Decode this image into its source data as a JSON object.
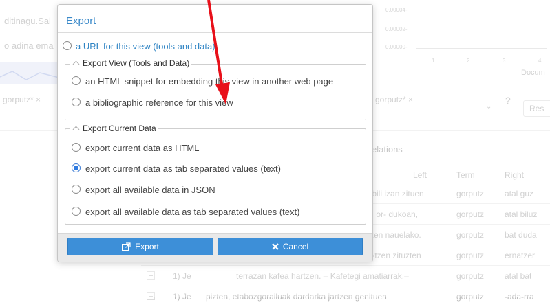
{
  "background": {
    "left_text_1": "ditinagu.Sal",
    "left_text_2": "o adina ema",
    "chip_left": "gorputz*",
    "chip_left_x": "×",
    "chip_right": "gorputz*",
    "chip_right_x": "×",
    "help": "?",
    "reset": "Res",
    "relations": "elations",
    "chart_ticks_y": [
      "0.00004-",
      "0.00002-",
      "0.00000-"
    ],
    "chart_ticks_x": [
      "1",
      "2",
      "3",
      "4"
    ],
    "chart_side_label": "Docum",
    "table": {
      "headers": [
        "Left",
        "Term",
        "Right"
      ],
      "rows": [
        {
          "id": "",
          "left": "erabili izan zituen",
          "term": "gorputz",
          "right": "atal guz"
        },
        {
          "id": "",
          "left": "eta, or- dukoan,",
          "term": "gorputz",
          "right": "atal biluz"
        },
        {
          "id": "",
          "left": "ratzen nauelako.",
          "term": "gorputz",
          "right": "bat duda"
        },
        {
          "id": "",
          "left": "arri-tzen zituzten",
          "term": "gorputz",
          "right": "ernatzer"
        },
        {
          "id": "1) Je",
          "left": "terrazan kafea hartzen. – Kafetegi amatiarrak.–",
          "term": "gorputz",
          "right": "atal bat"
        },
        {
          "id": "1) Je",
          "left": "pizten, etabozgorailuak dardarka jartzen genituen",
          "term": "gorputz",
          "right": "-ada-rra"
        }
      ]
    }
  },
  "dialog": {
    "title": "Export",
    "url_option": "a URL for this view (tools and data)",
    "view_group": {
      "legend": "Export View (Tools and Data)",
      "options": [
        "an HTML snippet for embedding this view in another web page",
        "a bibliographic reference for this view"
      ]
    },
    "data_group": {
      "legend": "Export Current Data",
      "options": [
        "export current data as HTML",
        "export current data as tab separated values (text)",
        "export all available data in JSON",
        "export all available data as tab separated values (text)"
      ],
      "selected": "export current data as tab separated values (text)"
    },
    "buttons": {
      "export": "Export",
      "export_icon": "external-link-icon",
      "cancel": "Cancel",
      "cancel_icon": "x-icon"
    }
  },
  "colors": {
    "accent": "#3a89c9",
    "button": "#3d8fd8",
    "annotation_arrow": "#e8101a"
  }
}
